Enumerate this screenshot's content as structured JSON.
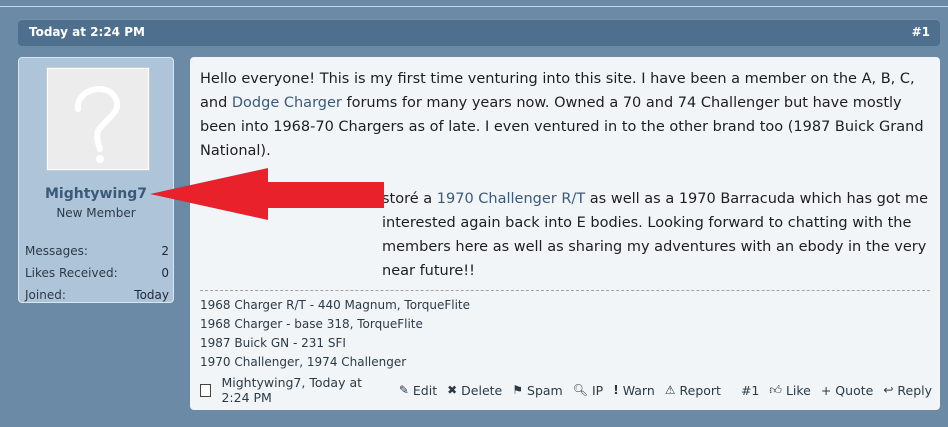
{
  "header": {
    "date": "Today at 2:24 PM",
    "post_number": "#1"
  },
  "user": {
    "name": "Mightywing7",
    "title": "New Member",
    "stats": [
      {
        "label": "Messages:",
        "value": "2"
      },
      {
        "label": "Likes Received:",
        "value": "0"
      },
      {
        "label": "Joined:",
        "value": "Today"
      }
    ]
  },
  "message": {
    "p1_a": "Hello everyone! This is my first time venturing into this site. I have been a member on the A, B, C, and ",
    "p1_link": "Dodge Charger",
    "p1_b": " forums for many years now. Owned a 70 and 74 Challenger but have mostly been into 1968-70 Chargers as of late. I even ventured in to the other brand too (1987 Buick Grand National).",
    "p2_a": "storé a ",
    "p2_link": "1970 Challenger R/T",
    "p2_b": " as well as a 1970 Barracuda which has got me interested again back into E bodies. Looking forward to chatting with the members here as well as sharing my adventures with an ebody in the very near future!!"
  },
  "signature": [
    "1968 Charger R/T - 440 Magnum, TorqueFlite",
    "1968 Charger - base 318, TorqueFlite",
    "1987 Buick GN - 231 SFI",
    "1970 Challenger, 1974 Challenger"
  ],
  "footer": {
    "meta": "Mightywing7, Today at 2:24 PM",
    "edit": "Edit",
    "delete": "Delete",
    "spam": "Spam",
    "ip": "IP",
    "warn": "Warn",
    "report": "Report",
    "number": "#1",
    "like": "Like",
    "quote": "+ Quote",
    "reply": "Reply"
  },
  "colors": {
    "header_bg": "#4f6f8f",
    "panel_bg": "#aec4d8",
    "link": "#3b5a7a",
    "arrow": "#e8212b"
  }
}
